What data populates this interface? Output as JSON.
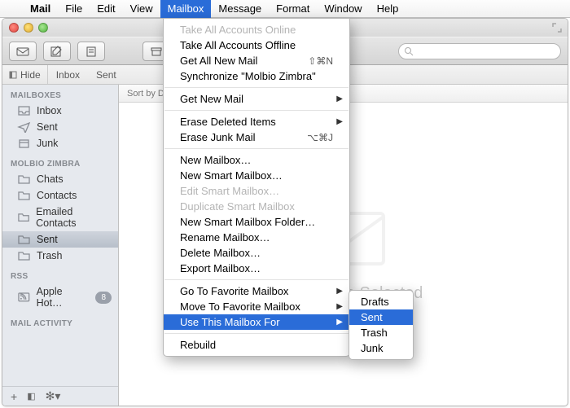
{
  "menubar": {
    "app": "Mail",
    "items": [
      "File",
      "Edit",
      "View",
      "Mailbox",
      "Message",
      "Format",
      "Window",
      "Help"
    ],
    "active": "Mailbox"
  },
  "favbar": {
    "hide": "Hide",
    "items": [
      "Inbox",
      "Sent"
    ]
  },
  "search": {
    "placeholder": ""
  },
  "sidebar": {
    "sections": [
      {
        "title": "MAILBOXES",
        "items": [
          {
            "icon": "inbox",
            "label": "Inbox"
          },
          {
            "icon": "sent",
            "label": "Sent"
          },
          {
            "icon": "junk",
            "label": "Junk"
          }
        ]
      },
      {
        "title": "MOLBIO ZIMBRA",
        "items": [
          {
            "icon": "folder",
            "label": "Chats"
          },
          {
            "icon": "folder",
            "label": "Contacts"
          },
          {
            "icon": "folder",
            "label": "Emailed Contacts"
          },
          {
            "icon": "folder",
            "label": "Sent",
            "selected": true
          },
          {
            "icon": "folder",
            "label": "Trash"
          }
        ]
      },
      {
        "title": "RSS",
        "items": [
          {
            "icon": "rss",
            "label": "Apple Hot…",
            "badge": "8"
          }
        ]
      },
      {
        "title": "MAIL ACTIVITY",
        "items": []
      }
    ]
  },
  "sortbar": {
    "label": "Sort by Da"
  },
  "preview": {
    "message": "No Message Selected"
  },
  "menu": {
    "groups": [
      [
        {
          "label": "Take All Accounts Online",
          "disabled": true
        },
        {
          "label": "Take All Accounts Offline"
        },
        {
          "label": "Get All New Mail",
          "shortcut": "⇧⌘N"
        },
        {
          "label": "Synchronize \"Molbio Zimbra\""
        }
      ],
      [
        {
          "label": "Get New Mail",
          "submenu": true
        }
      ],
      [
        {
          "label": "Erase Deleted Items",
          "submenu": true
        },
        {
          "label": "Erase Junk Mail",
          "shortcut": "⌥⌘J"
        }
      ],
      [
        {
          "label": "New Mailbox…"
        },
        {
          "label": "New Smart Mailbox…"
        },
        {
          "label": "Edit Smart Mailbox…",
          "disabled": true
        },
        {
          "label": "Duplicate Smart Mailbox",
          "disabled": true
        },
        {
          "label": "New Smart Mailbox Folder…"
        },
        {
          "label": "Rename Mailbox…"
        },
        {
          "label": "Delete Mailbox…"
        },
        {
          "label": "Export Mailbox…"
        }
      ],
      [
        {
          "label": "Go To Favorite Mailbox",
          "submenu": true
        },
        {
          "label": "Move To Favorite Mailbox",
          "submenu": true
        },
        {
          "label": "Use This Mailbox For",
          "submenu": true,
          "highlight": true
        }
      ],
      [
        {
          "label": "Rebuild"
        }
      ]
    ]
  },
  "submenu": {
    "items": [
      "Drafts",
      "Sent",
      "Trash",
      "Junk"
    ],
    "highlight": "Sent"
  }
}
